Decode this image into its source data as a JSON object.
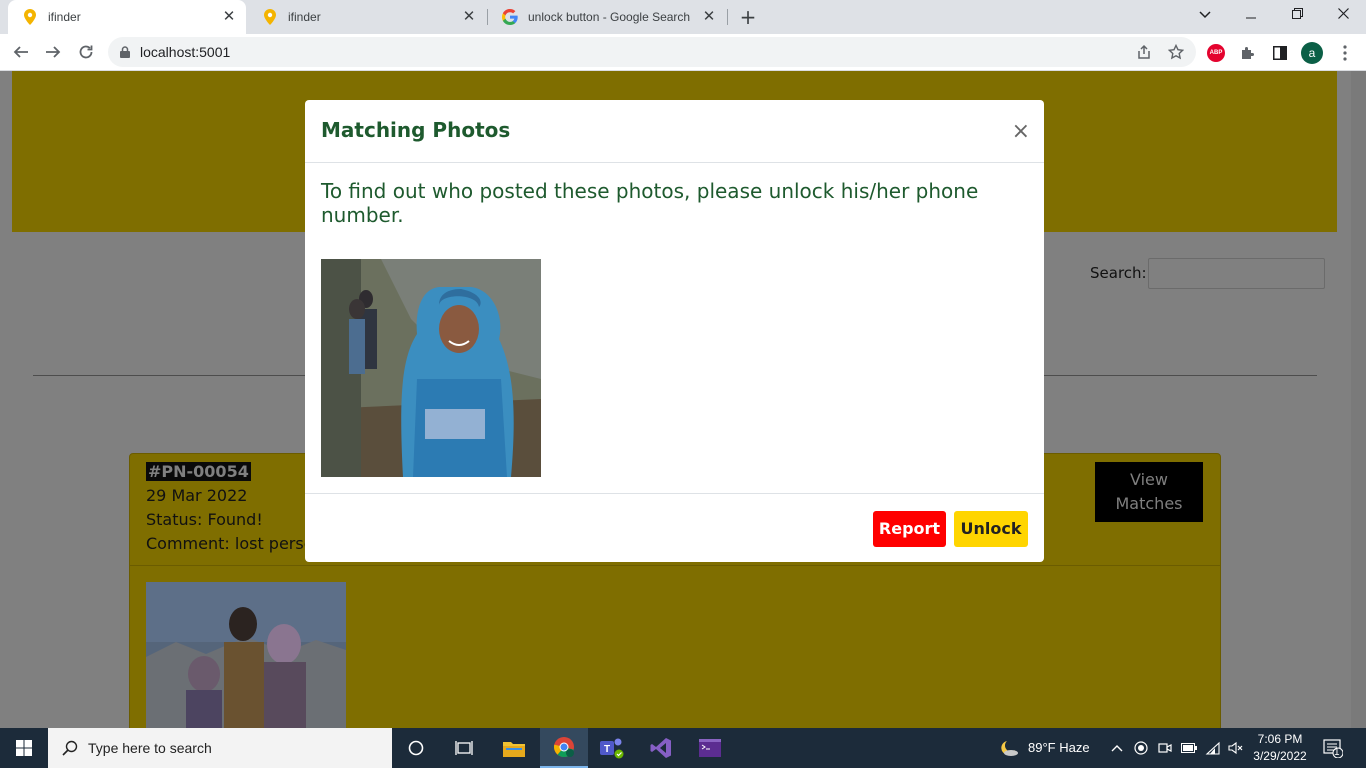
{
  "browser": {
    "tabs": [
      {
        "title": "ifinder",
        "favicon": "map-pin-icon",
        "active": true
      },
      {
        "title": "ifinder",
        "favicon": "map-pin-icon",
        "active": false
      },
      {
        "title": "unlock button - Google Search",
        "favicon": "google-icon",
        "active": false
      }
    ],
    "url": "localhost:5001",
    "profile_initial": "a",
    "abp_label": "ABP"
  },
  "page": {
    "search_label": "Search:",
    "search_value": "",
    "card": {
      "id": "#PN-00054",
      "date": "29 Mar 2022",
      "status": "Status: Found!",
      "comment": "Comment: lost perso",
      "view_matches_line1": "View",
      "view_matches_line2": "Matches"
    }
  },
  "modal": {
    "title": "Matching Photos",
    "close_glyph": "×",
    "message": "To find out who posted these photos, please unlock his/her phone number.",
    "report_label": "Report",
    "unlock_label": "Unlock"
  },
  "taskbar": {
    "search_placeholder": "Type here to search",
    "weather": "89°F  Haze",
    "time": "7:06 PM",
    "date": "3/29/2022",
    "notification_count": "1"
  },
  "colors": {
    "accent_yellow": "#ffd500",
    "report_red": "#ff0000",
    "title_green": "#1e5a2e"
  }
}
